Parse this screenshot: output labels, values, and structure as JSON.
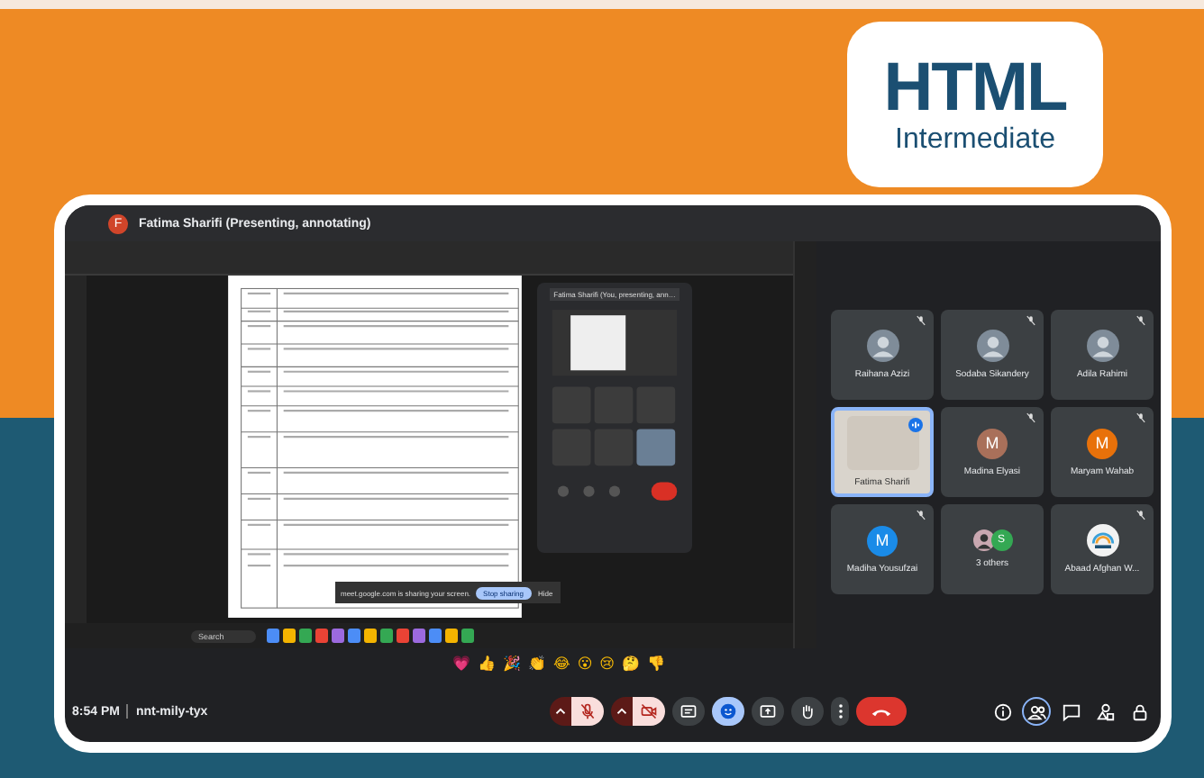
{
  "badge": {
    "title": "HTML",
    "subtitle": "Intermediate"
  },
  "meeting": {
    "presenter_initial": "F",
    "title": "Fatima Sharifi (Presenting, annotating)"
  },
  "shared_screen": {
    "mini_window": {
      "title": "Fatima Sharifi (You, presenting, ann…"
    },
    "share_notice": {
      "text": "meet.google.com is sharing your screen.",
      "stop": "Stop sharing",
      "hide": "Hide"
    },
    "taskbar": {
      "search_placeholder": "Search"
    }
  },
  "participants": [
    {
      "name": "Raihana Azizi",
      "kind": "photo",
      "muted": true,
      "speaking": false,
      "selected": false
    },
    {
      "name": "Sodaba Sikandery",
      "kind": "photo",
      "muted": true,
      "speaking": false,
      "selected": false
    },
    {
      "name": "Adila Rahimi",
      "kind": "photo",
      "muted": true,
      "speaking": false,
      "selected": false
    },
    {
      "name": "Fatima Sharifi",
      "kind": "video",
      "muted": false,
      "speaking": true,
      "selected": true
    },
    {
      "name": "Madina Elyasi",
      "kind": "letter",
      "letter": "M",
      "color": "#a9705a",
      "muted": true,
      "speaking": false,
      "selected": false
    },
    {
      "name": "Maryam Wahab",
      "kind": "letter",
      "letter": "M",
      "color": "#e8710a",
      "muted": true,
      "speaking": false,
      "selected": false
    },
    {
      "name": "Madiha Yousufzai",
      "kind": "letter",
      "letter": "M",
      "color": "#1a8be8",
      "muted": true,
      "speaking": false,
      "selected": false
    },
    {
      "name": "3 others",
      "kind": "group",
      "letter": "S",
      "color": "#34a853",
      "muted": false,
      "speaking": false,
      "selected": false
    },
    {
      "name": "Abaad Afghan W...",
      "kind": "logo",
      "muted": true,
      "speaking": false,
      "selected": false
    }
  ],
  "reactions": [
    "💗",
    "👍",
    "🎉",
    "👏",
    "😂",
    "😮",
    "😢",
    "🤔",
    "👎"
  ],
  "toolbar": {
    "time": "8:54 PM",
    "meeting_code": "nnt-mily-tyx",
    "controls": [
      {
        "kind": "mic",
        "on": false
      },
      {
        "kind": "camera",
        "on": false
      },
      {
        "kind": "captions",
        "active": false
      },
      {
        "kind": "reactions",
        "active": true
      },
      {
        "kind": "present",
        "active": false
      },
      {
        "kind": "hand",
        "active": false
      },
      {
        "kind": "more"
      },
      {
        "kind": "end"
      }
    ],
    "side": [
      {
        "kind": "info",
        "active": false
      },
      {
        "kind": "people",
        "active": true
      },
      {
        "kind": "chat",
        "active": false
      },
      {
        "kind": "activities",
        "active": false
      },
      {
        "kind": "lock",
        "active": false
      }
    ]
  }
}
